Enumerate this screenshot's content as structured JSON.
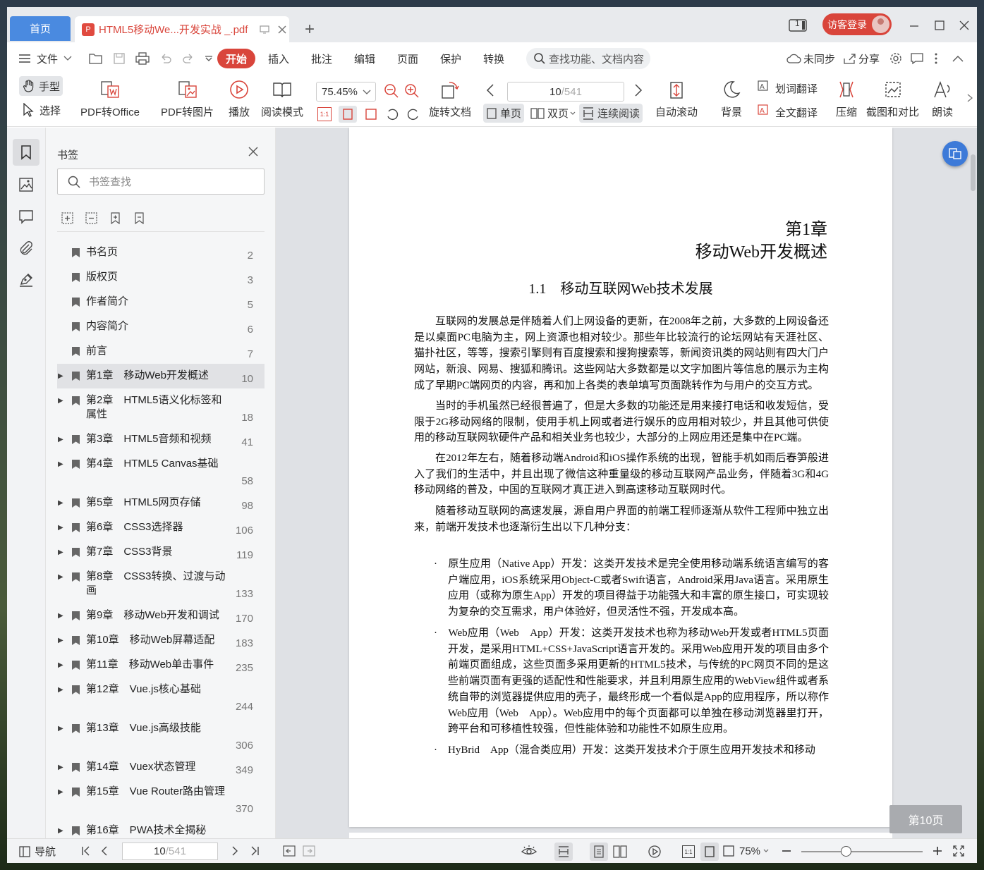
{
  "tabs": {
    "home": "首页",
    "document": "HTML5移动We...开发实战 _.pdf",
    "pdf_badge": "P"
  },
  "titlebar": {
    "page_count_badge": "1",
    "login": "访客登录"
  },
  "menu": {
    "file": "文件",
    "start": "开始",
    "insert": "插入",
    "annotate": "批注",
    "edit": "编辑",
    "page": "页面",
    "protect": "保护",
    "convert": "转换",
    "search_placeholder": "查找功能、文档内容",
    "sync": "未同步",
    "share": "分享"
  },
  "toolbar": {
    "hand": "手型",
    "select": "选择",
    "pdf_to_office": "PDF转Office",
    "pdf_to_image": "PDF转图片",
    "play": "播放",
    "read_mode": "阅读模式",
    "zoom": "75.45%",
    "rotate_doc": "旋转文档",
    "page_current": "10",
    "page_total": "/541",
    "single": "单页",
    "double": "双页",
    "continuous": "连续阅读",
    "auto_scroll": "自动滚动",
    "background": "背景",
    "word_translate": "划词翻译",
    "full_translate": "全文翻译",
    "compress": "压缩",
    "screenshot_compare": "截图和对比",
    "read_aloud": "朗读",
    "ratio_1to1": "1:1"
  },
  "bookmarks": {
    "title": "书签",
    "search_placeholder": "书签查找",
    "items": [
      {
        "label": "书名页",
        "page": "2",
        "expandable": false
      },
      {
        "label": "版权页",
        "page": "3",
        "expandable": false
      },
      {
        "label": "作者简介",
        "page": "5",
        "expandable": false
      },
      {
        "label": "内容简介",
        "page": "6",
        "expandable": false
      },
      {
        "label": "前言",
        "page": "7",
        "expandable": false
      },
      {
        "label": "第1章　移动Web开发概述",
        "page": "10",
        "expandable": true,
        "active": true
      },
      {
        "label": "第2章　HTML5语义化标签和属性",
        "page": "18",
        "expandable": true
      },
      {
        "label": "第3章　HTML5音频和视频",
        "page": "41",
        "expandable": true
      },
      {
        "label": "第4章　HTML5 Canvas基础",
        "page": "58",
        "expandable": true
      },
      {
        "label": "第5章　HTML5网页存储",
        "page": "98",
        "expandable": true
      },
      {
        "label": "第6章　CSS3选择器",
        "page": "106",
        "expandable": true
      },
      {
        "label": "第7章　CSS3背景",
        "page": "119",
        "expandable": true
      },
      {
        "label": "第8章　CSS3转换、过渡与动画",
        "page": "133",
        "expandable": true
      },
      {
        "label": "第9章　移动Web开发和调试",
        "page": "170",
        "expandable": true
      },
      {
        "label": "第10章　移动Web屏幕适配",
        "page": "183",
        "expandable": true
      },
      {
        "label": "第11章　移动Web单击事件",
        "page": "235",
        "expandable": true
      },
      {
        "label": "第12章　Vue.js核心基础",
        "page": "244",
        "expandable": true
      },
      {
        "label": "第13章　Vue.js高级技能",
        "page": "306",
        "expandable": true
      },
      {
        "label": "第14章　Vuex状态管理",
        "page": "349",
        "expandable": true
      },
      {
        "label": "第15章　Vue Router路由管理",
        "page": "370",
        "expandable": true
      },
      {
        "label": "第16章　PWA技术全揭秘",
        "page": "",
        "expandable": true
      }
    ]
  },
  "document": {
    "chapter_number": "第1章",
    "chapter_title": "移动Web开发概述",
    "section_title": "1.1　移动互联网Web技术发展",
    "paragraphs": [
      "互联网的发展总是伴随着人们上网设备的更新，在2008年之前，大多数的上网设备还是以桌面PC电脑为主，网上资源也相对较少。那些年比较流行的论坛网站有天涯社区、猫扑社区，等等，搜索引擎则有百度搜索和搜狗搜索等，新闻资讯类的网站则有四大门户网站，新浪、网易、搜狐和腾讯。这些网站大多数都是以文字加图片等信息的展示为主构成了早期PC端网页的内容，再和加上各类的表单填写页面跳转作为与用户的交互方式。",
      "当时的手机虽然已经很普遍了，但是大多数的功能还是用来接打电话和收发短信，受限于2G移动网络的限制，使用手机上网或者进行娱乐的应用相对较少，并且其他可供使用的移动互联网软硬件产品和相关业务也较少，大部分的上网应用还是集中在PC端。",
      "在2012年左右，随着移动端Android和iOS操作系统的出现，智能手机如雨后春笋般进入了我们的生活中，并且出现了微信这种重量级的移动互联网产品业务，伴随着3G和4G移动网络的普及，中国的互联网才真正进入到高速移动互联网时代。",
      "随着移动互联网的高速发展，源自用户界面的前端工程师逐渐从软件工程师中独立出来，前端开发技术也逐渐衍生出以下几种分支："
    ],
    "bullets": [
      "·　原生应用（Native App）开发：这类开发技术是完全使用移动端系统语言编写的客户端应用，iOS系统采用Object-C或者Swift语言，Android采用Java语言。采用原生应用（或称为原生App）开发的项目得益于功能强大和丰富的原生接口，可实现较为复杂的交互需求，用户体验好，但灵活性不强，开发成本高。",
      "·　Web应用（Web　App）开发：这类开发技术也称为移动Web开发或者HTML5页面开发，是采用HTML+CSS+JavaScript语言开发的。采用Web应用开发的项目由多个前端页面组成，这些页面多采用更新的HTML5技术，与传统的PC网页不同的是这些前端页面有更强的适配性和性能要求，并且利用原生应用的WebView组件或者系统自带的浏览器提供应用的壳子，最终形成一个看似是App的应用程序，所以称作Web应用（Web　App）。Web应用中的每个页面都可以单独在移动浏览器里打开，跨平台和可移植性较强，但性能体验和功能性不如原生应用。",
      "·　HyBrid　App（混合类应用）开发：这类开发技术介于原生应用开发技术和移动"
    ],
    "page_badge": "第10页"
  },
  "statusbar": {
    "nav": "导航",
    "page_current": "10",
    "page_total": "/541",
    "zoom": "75%",
    "ratio_1to1": "1:1"
  }
}
